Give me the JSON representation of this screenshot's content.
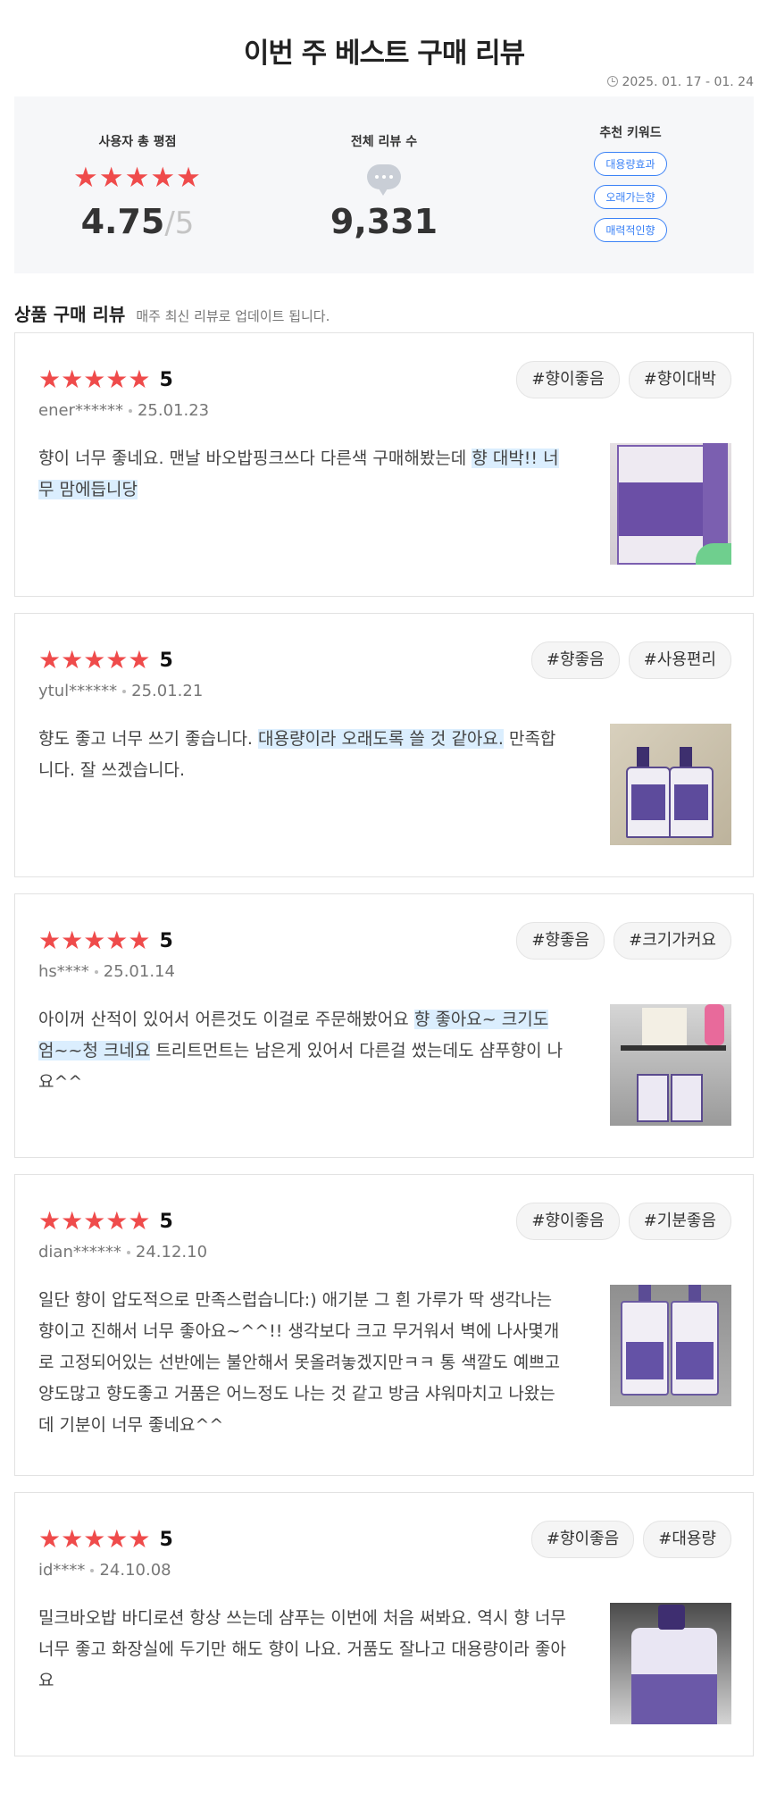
{
  "header": {
    "title": "이번 주 베스트 구매 리뷰",
    "period": "2025. 01. 17 - 01. 24"
  },
  "summary": {
    "rating_label": "사용자 총 평점",
    "rating_stars": "★★★★★",
    "rating_value": "4.75",
    "rating_max": "5",
    "count_label": "전체 리뷰 수",
    "count_value": "9,331",
    "keyword_label": "추천 키워드",
    "keywords": [
      "대용량효과",
      "오래가는향",
      "매력적인향"
    ]
  },
  "section": {
    "title": "상품 구매 리뷰",
    "subtitle": "매주 최신 리뷰로 업데이트 됩니다."
  },
  "reviews": [
    {
      "stars": "★★★★★",
      "rating": "5",
      "user": "ener******",
      "date": "25.01.23",
      "tags": [
        "#향이좋음",
        "#향이대박"
      ],
      "text_pre": "향이 너무 좋네요. 맨날 바오밥핑크쓰다 다른색 구매해봤는데 ",
      "text_hl": "향 대박!! 너무 맘에듭니당",
      "text_post": ""
    },
    {
      "stars": "★★★★★",
      "rating": "5",
      "user": "ytul******",
      "date": "25.01.21",
      "tags": [
        "#향좋음",
        "#사용편리"
      ],
      "text_pre": "향도 좋고 너무 쓰기 좋습니다. ",
      "text_hl": "대용량이라 오래도록 쓸 것 같아요.",
      "text_post": " 만족합니다. 잘 쓰겠습니다."
    },
    {
      "stars": "★★★★★",
      "rating": "5",
      "user": "hs****",
      "date": "25.01.14",
      "tags": [
        "#향좋음",
        "#크기가커요"
      ],
      "text_pre": "아이꺼 산적이 있어서 어른것도 이걸로 주문해봤어요 ",
      "text_hl": "향 좋아요~ 크기도 엄~~청 크네요",
      "text_post": " 트리트먼트는 남은게 있어서 다른걸 썼는데도 샴푸향이 나요^^"
    },
    {
      "stars": "★★★★★",
      "rating": "5",
      "user": "dian******",
      "date": "24.12.10",
      "tags": [
        "#향이좋음",
        "#기분좋음"
      ],
      "text_pre": "일단 향이 압도적으로 만족스럽습니다:) 애기분 그 흰 가루가 딱 생각나는 향이고 진해서 너무 좋아요~^^!! 생각보다 크고 무거워서 벽에 나사몇개로 고정되어있는 선반에는 불안해서 못올려놓겠지만ㅋㅋ 통 색깔도 예쁘고 양도많고 향도좋고 거품은 어느정도 나는 것 같고 방금 샤워마치고 나왔는데 기분이 너무 좋네요^^",
      "text_hl": "",
      "text_post": ""
    },
    {
      "stars": "★★★★★",
      "rating": "5",
      "user": "id****",
      "date": "24.10.08",
      "tags": [
        "#향이좋음",
        "#대용량"
      ],
      "text_pre": "밀크바오밥 바디로션 항상 쓰는데 샴푸는 이번에 처음 써봐요. 역시 향 너무 너무 좋고 화장실에 두기만 해도 향이 나요. 거품도 잘나고 대용량이라 좋아요",
      "text_hl": "",
      "text_post": ""
    }
  ]
}
